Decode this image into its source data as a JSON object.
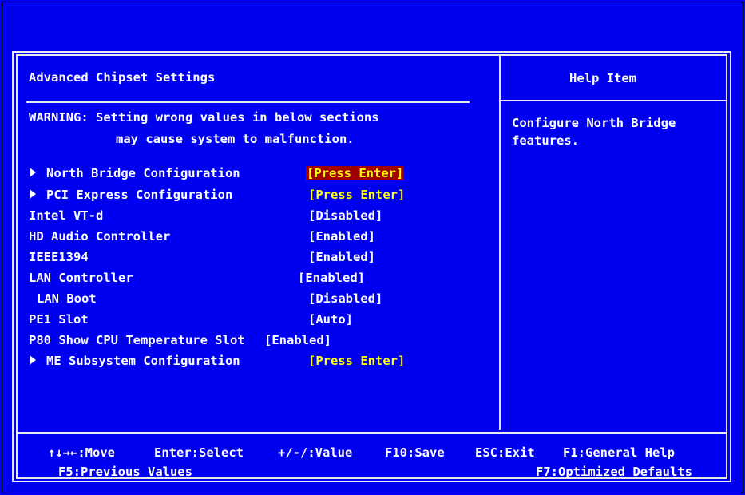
{
  "page_title": "Advanced Chipset Settings",
  "warning_line1": "WARNING: Setting wrong values in below sections",
  "warning_line2": "may cause system to malfunction.",
  "help_title": "Help Item",
  "help_text_line1": "Configure North Bridge",
  "help_text_line2": "features.",
  "items": [
    {
      "label": "North Bridge Configuration",
      "value": "[Press Enter]"
    },
    {
      "label": "PCI Express Configuration",
      "value": "[Press Enter]"
    },
    {
      "label": "Intel VT-d",
      "value": "[Disabled]"
    },
    {
      "label": "HD Audio Controller",
      "value": "[Enabled]"
    },
    {
      "label": "IEEE1394",
      "value": "[Enabled]"
    },
    {
      "label": "LAN Controller",
      "value": "[Enabled]"
    },
    {
      "label": "LAN Boot",
      "value": "[Disabled]"
    },
    {
      "label": "PE1 Slot",
      "value": "[Auto]"
    },
    {
      "label": "P80 Show CPU Temperature Slot",
      "value": "[Enabled]"
    },
    {
      "label": "ME Subsystem Configuration",
      "value": "[Press Enter]"
    }
  ],
  "footer": {
    "move": "↑↓→←:Move",
    "select": "Enter:Select",
    "value": "+/-/:Value",
    "save": "F10:Save",
    "exit": "ESC:Exit",
    "general_help": "F1:General Help",
    "previous_values": "F5:Previous Values",
    "optimized_defaults": "F7:Optimized Defaults"
  },
  "colors": {
    "background": "#0000f0",
    "text": "#ffffff",
    "submenu_value": "#ffff00",
    "selection_highlight": "#a00000"
  }
}
